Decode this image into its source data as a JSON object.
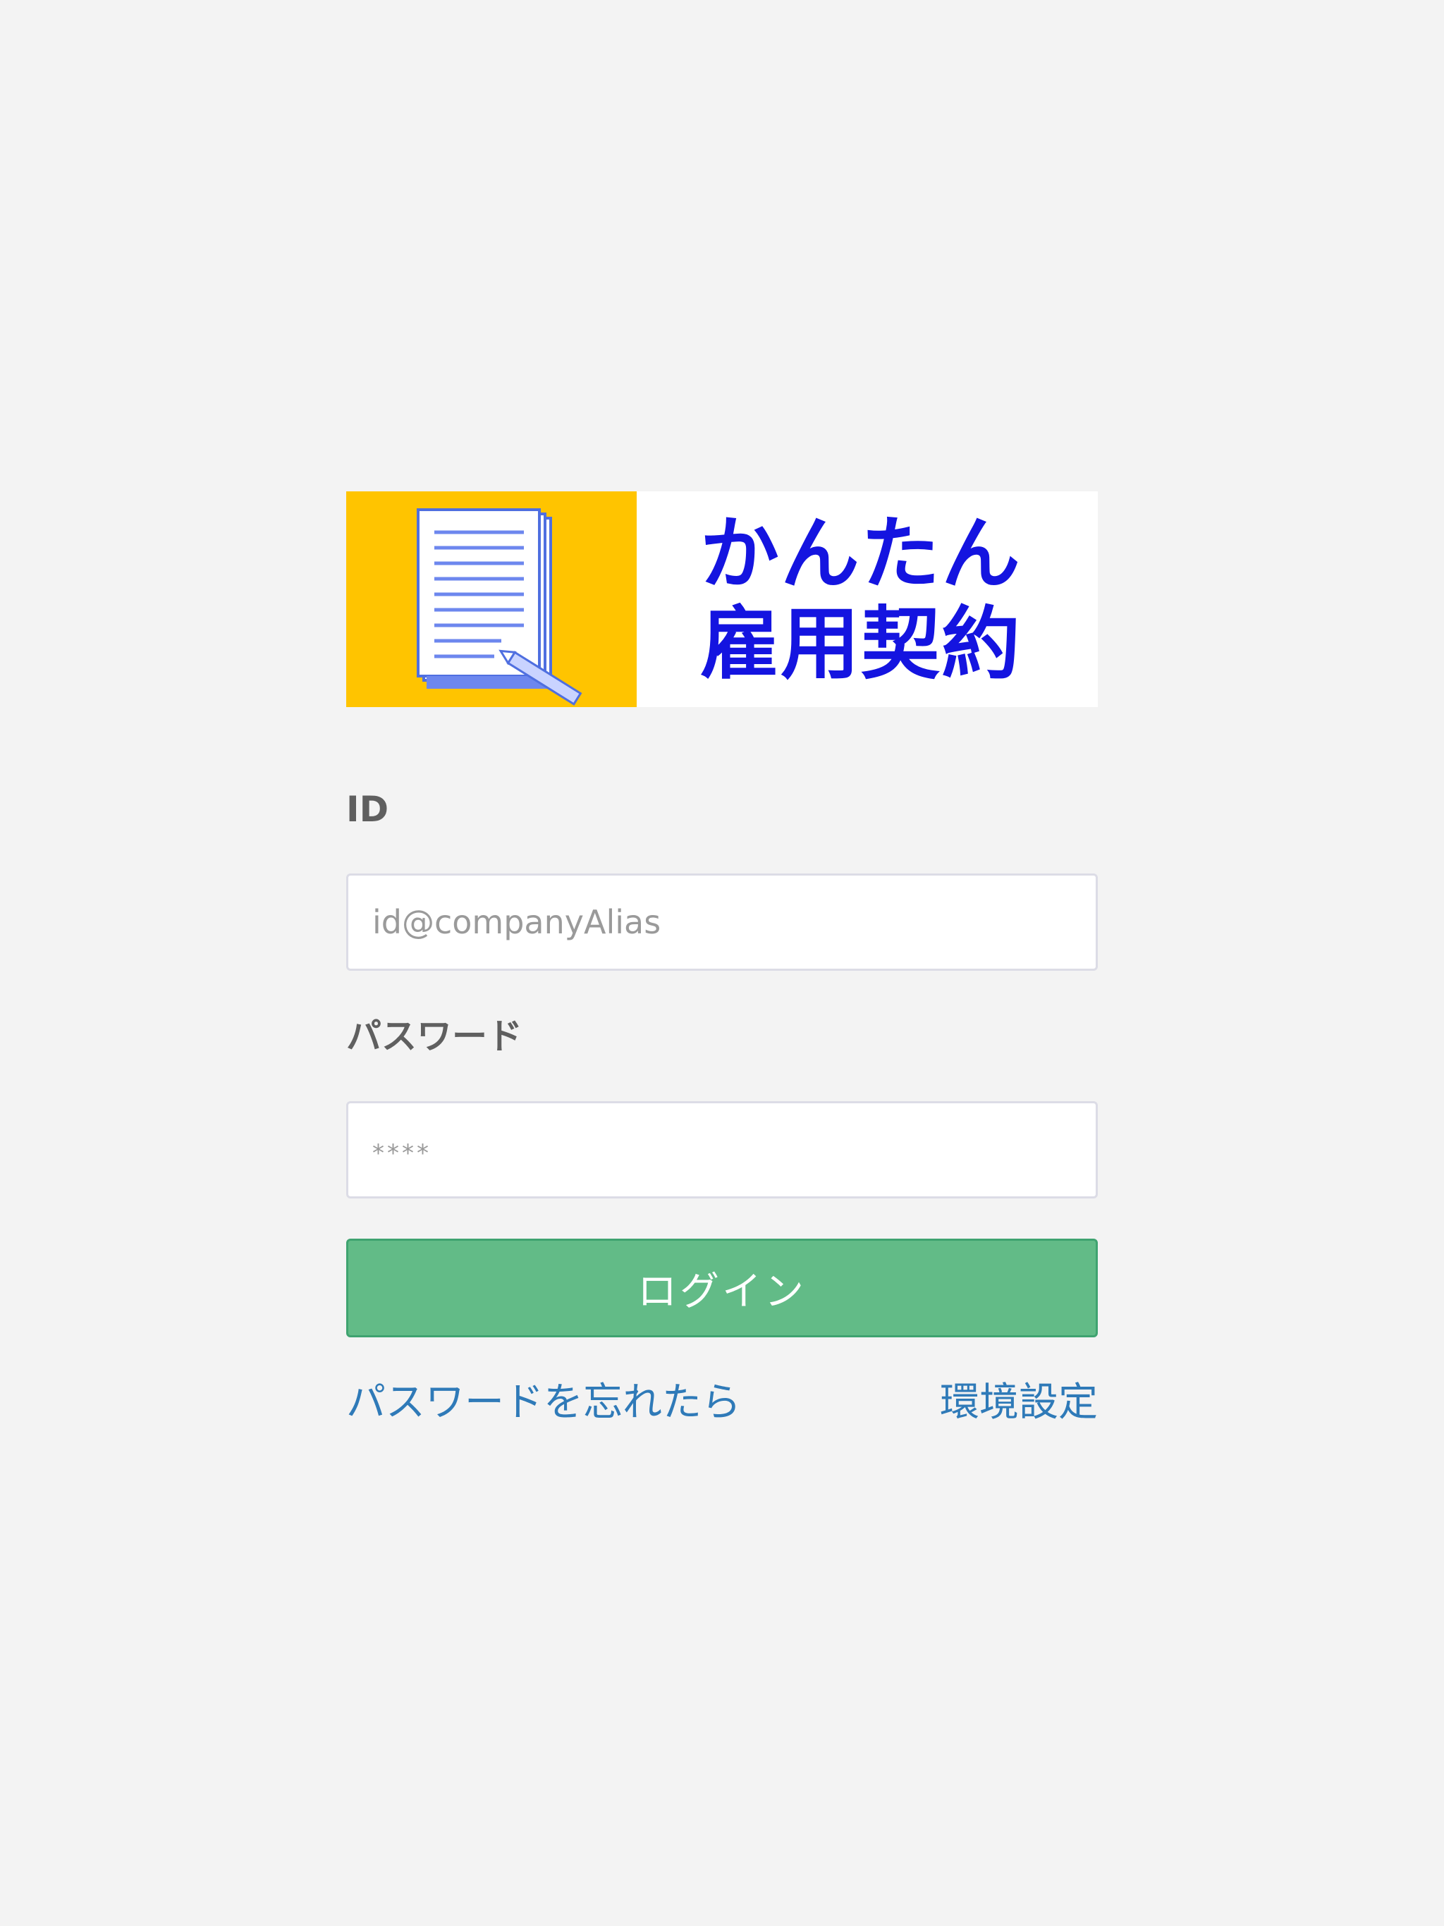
{
  "logo": {
    "line1": "かんたん",
    "line2": "雇用契約",
    "colors": {
      "left_bg": "#ffc400",
      "right_bg": "#ffffff",
      "text": "#1414e0"
    },
    "icon": "document-pencil-icon"
  },
  "form": {
    "id_label": "ID",
    "id_placeholder": "id@companyAlias",
    "id_value": "",
    "password_label": "パスワード",
    "password_placeholder": "****",
    "password_value": "",
    "login_label": "ログイン"
  },
  "links": {
    "forgot_password": "パスワードを忘れたら",
    "settings": "環境設定"
  },
  "colors": {
    "background": "#f3f3f3",
    "button": "#62bb87",
    "link": "#2f7ab8",
    "label": "#5f5f5f"
  }
}
